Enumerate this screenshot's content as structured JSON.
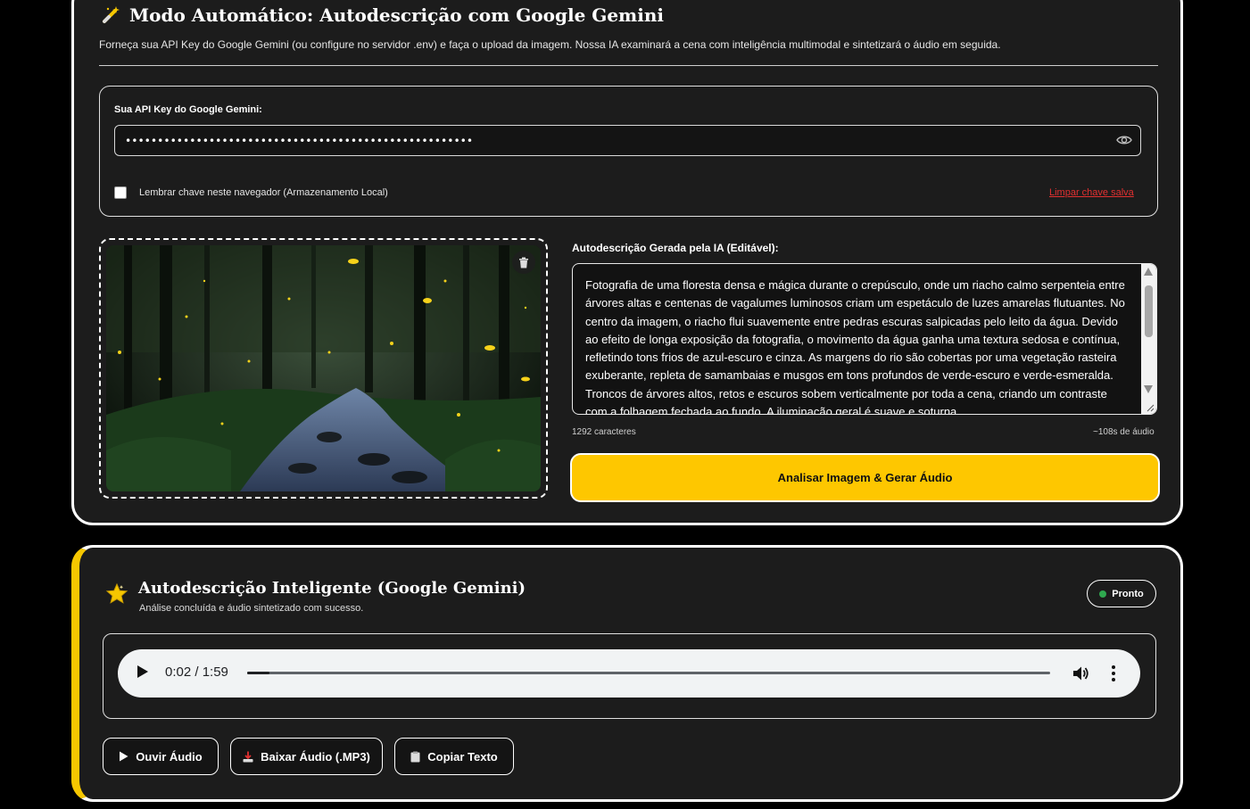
{
  "auto_mode": {
    "title": "Modo Automático: Autodescrição com Google Gemini",
    "title_icon": "magic-wand-icon",
    "subtitle": "Forneça sua API Key do Google Gemini (ou configure no servidor .env) e faça o upload da imagem. Nossa IA examinará a cena com inteligência multimodal e sintetizará o áudio em seguida.",
    "api": {
      "label": "Sua API Key do Google Gemini:",
      "masked_value": "••••••••••••••••••••••••••••••••••••••••••••••••••••••",
      "remember_label": "Lembrar chave neste navegador (Armazenamento Local)",
      "remember_checked": false,
      "clear_link": "Limpar chave salva"
    },
    "description": {
      "label": "Autodescrição Gerada pela IA (Editável):",
      "text": "Fotografia de uma floresta densa e mágica durante o crepúsculo, onde um riacho calmo serpenteia entre árvores altas e centenas de vagalumes luminosos criam um espetáculo de luzes amarelas flutuantes. No centro da imagem, o riacho flui suavemente entre pedras escuras salpicadas pelo leito da água. Devido ao efeito de longa exposição da fotografia, o movimento da água ganha uma textura sedosa e contínua, refletindo tons frios de azul-escuro e cinza. As margens do rio são cobertas por uma vegetação rasteira exuberante, repleta de samambaias e musgos em tons profundos de verde-escuro e verde-esmeralda. Troncos de árvores altos, retos e escuros sobem verticalmente por toda a cena, criando um contraste com a folhagem fechada ao fundo. A iluminação geral é suave e soturna.",
      "char_count": "1292 caracteres",
      "audio_estimate": "~108s de áudio"
    },
    "analyze_button": "Analisar Imagem & Gerar Áudio"
  },
  "result": {
    "title": "Autodescrição Inteligente (Google Gemini)",
    "subtitle": "Análise concluída e áudio sintetizado com sucesso.",
    "status": "Pronto",
    "status_color": "#2fa84f",
    "player": {
      "time": "0:02 / 1:59",
      "progress": 0.028
    },
    "buttons": {
      "listen": "Ouvir Áudio",
      "download": "Baixar Áudio (.MP3)",
      "copy": "Copiar Texto"
    }
  },
  "colors": {
    "accent": "#fec700",
    "danger": "#e23030",
    "card_bg": "#1c1c1c"
  }
}
